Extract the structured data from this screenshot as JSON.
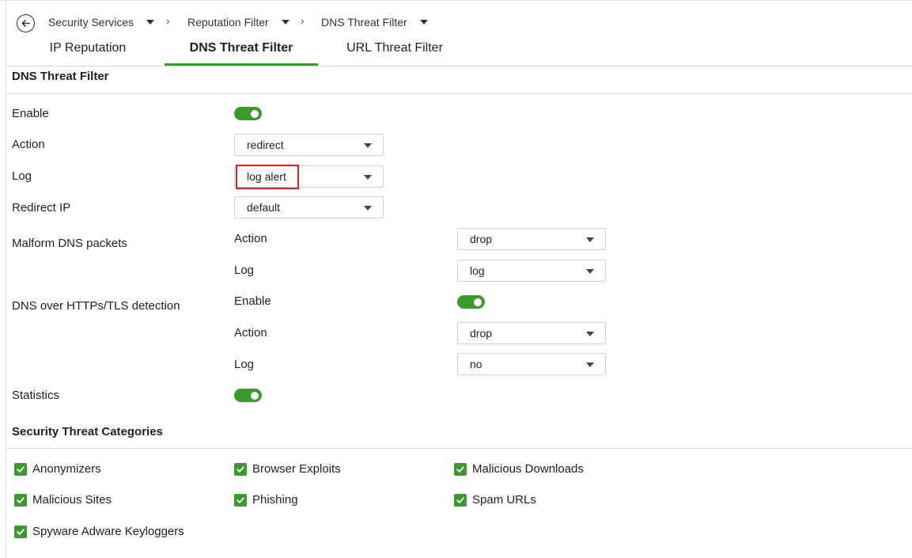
{
  "breadcrumb": {
    "items": [
      {
        "label": "Security Services"
      },
      {
        "label": "Reputation Filter"
      },
      {
        "label": "DNS Threat Filter"
      }
    ],
    "separator": "›"
  },
  "tabs": [
    {
      "label": "IP Reputation",
      "active": false
    },
    {
      "label": "DNS Threat Filter",
      "active": true
    },
    {
      "label": "URL Threat Filter",
      "active": false
    }
  ],
  "section_title": "DNS Threat Filter",
  "fields": {
    "enable": {
      "label": "Enable",
      "value": true
    },
    "action": {
      "label": "Action",
      "value": "redirect"
    },
    "log": {
      "label": "Log",
      "value": "log alert"
    },
    "redirect_ip": {
      "label": "Redirect IP",
      "value": "default"
    }
  },
  "malform": {
    "label": "Malform DNS packets",
    "action_label": "Action",
    "action_value": "drop",
    "log_label": "Log",
    "log_value": "log"
  },
  "doh": {
    "label": "DNS over HTTPs/TLS detection",
    "enable_label": "Enable",
    "enable_value": true,
    "action_label": "Action",
    "action_value": "drop",
    "log_label": "Log",
    "log_value": "no"
  },
  "statistics": {
    "label": "Statistics",
    "value": true
  },
  "categories": {
    "title": "Security Threat Categories",
    "items": [
      {
        "label": "Anonymizers",
        "checked": true
      },
      {
        "label": "Browser Exploits",
        "checked": true
      },
      {
        "label": "Malicious Downloads",
        "checked": true
      },
      {
        "label": "Malicious Sites",
        "checked": true
      },
      {
        "label": "Phishing",
        "checked": true
      },
      {
        "label": "Spam URLs",
        "checked": true
      },
      {
        "label": "Spyware Adware Keyloggers",
        "checked": true
      }
    ]
  },
  "colors": {
    "accent": "#3a9a2e",
    "highlight": "#d8232a"
  }
}
